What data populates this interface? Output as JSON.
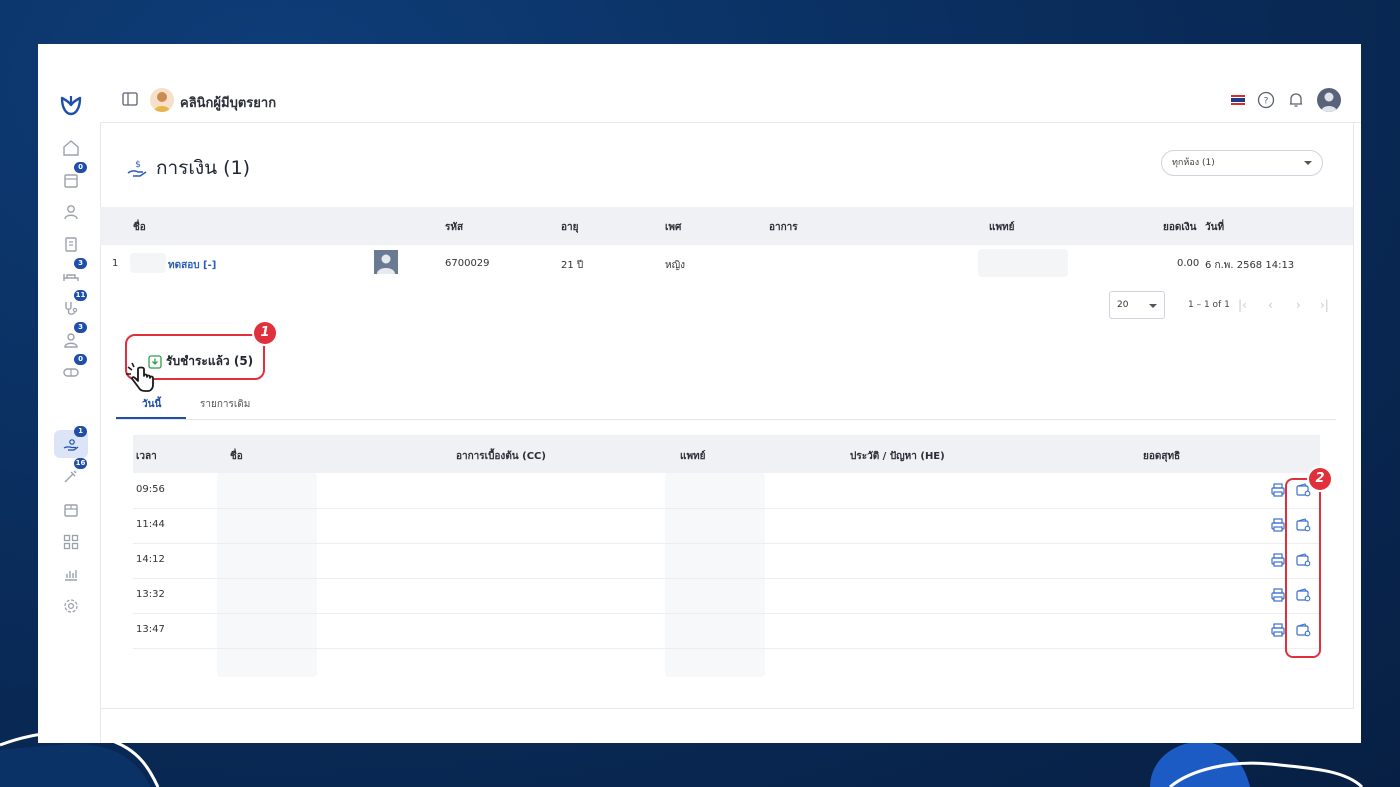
{
  "app": {
    "clinic_name": "คลินิกผู้มีบุตรยาก",
    "sidebar_badges": {
      "appointments": "0",
      "beds": "3",
      "treatment": "11",
      "queue": "3",
      "lab": "0",
      "finance": "1",
      "tools": "16"
    }
  },
  "finance": {
    "title": "การเงิน (1)",
    "room_filter": "ทุกห้อง (1)",
    "patients_table": {
      "headers": {
        "name": "ชื่อ",
        "code": "รหัส",
        "age": "อายุ",
        "gender": "เพศ",
        "symptom": "อาการ",
        "doctor": "แพทย์",
        "amount": "ยอดเงิน",
        "date": "วันที่"
      },
      "rows": [
        {
          "index": "1",
          "name": "ทดสอบ [-]",
          "code": "6700029",
          "age": "21 ปี",
          "gender": "หญิง",
          "amount": "0.00",
          "date": "6 ก.พ. 2568 14:13"
        }
      ]
    },
    "pagination": {
      "page_size": "20",
      "range": "1 – 1 of 1"
    },
    "paid_section": {
      "label": "รับชำระแล้ว (5)",
      "tabs": [
        "วันนี้",
        "รายการเดิม"
      ],
      "table": {
        "headers": {
          "time": "เวลา",
          "name": "ชื่อ",
          "cc": "อาการเบื้องต้น (CC)",
          "doctor": "แพทย์",
          "he": "ประวัติ / ปัญหา (HE)",
          "net": "ยอดสุทธิ"
        },
        "rows": [
          {
            "time": "09:56"
          },
          {
            "time": "11:44"
          },
          {
            "time": "14:12"
          },
          {
            "time": "13:32"
          },
          {
            "time": "13:47"
          }
        ]
      }
    }
  },
  "annotations": {
    "callout_1": "1",
    "callout_2": "2"
  },
  "colors": {
    "accent": "#1f4fa8",
    "callout": "#e0303b",
    "header_bg": "#f0f1f4"
  }
}
